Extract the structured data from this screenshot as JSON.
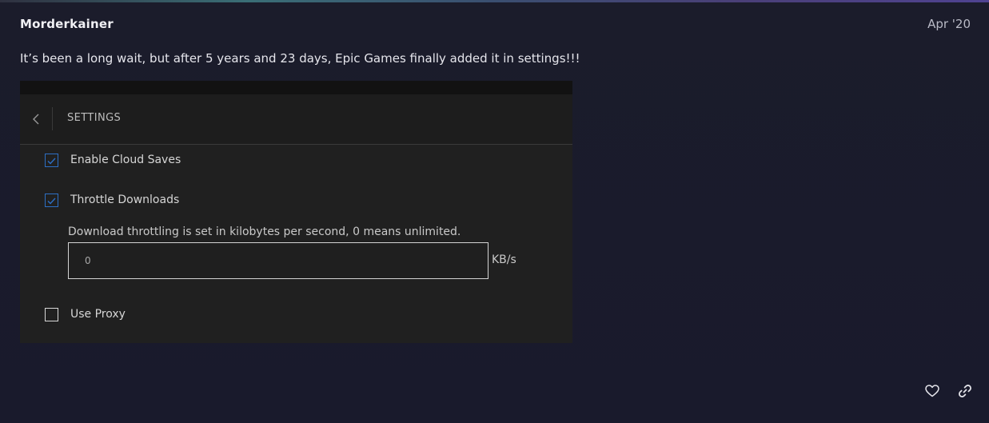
{
  "post": {
    "author": "Morderkainer",
    "date": "Apr '20",
    "message": "It’s been a long wait, but after 5 years and 23 days, Epic Games finally added it in settings!!!"
  },
  "screenshot": {
    "header_title": "SETTINGS",
    "options": [
      {
        "label": "Enable Cloud Saves",
        "checked": true
      },
      {
        "label": "Throttle Downloads",
        "checked": true
      },
      {
        "label": "Use Proxy",
        "checked": false
      }
    ],
    "throttle_hint": "Download throttling is set in kilobytes per second, 0 means unlimited.",
    "throttle_value": "0",
    "throttle_unit": "KB/s"
  },
  "icons": {
    "back": "chevron-left-icon",
    "check": "checkmark-icon",
    "like": "heart-icon",
    "share": "link-icon"
  },
  "colors": {
    "background": "#1a1a2e",
    "checkbox_accent": "#2d6fc4",
    "panel": "#202020"
  }
}
